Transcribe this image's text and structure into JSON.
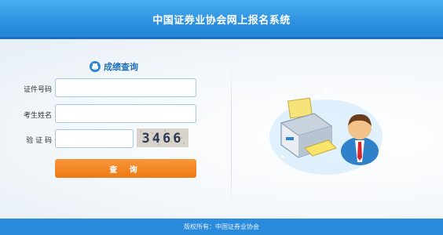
{
  "header": {
    "title": "中国证券业协会网上报名系统"
  },
  "form": {
    "title": "成绩查询",
    "id_label": "证件号码",
    "id_value": "",
    "name_label": "考生姓名",
    "name_value": "",
    "code_label": "验 证 码",
    "code_value": "",
    "captcha_text": "3466",
    "submit_label": "查 询"
  },
  "footer": {
    "text": "版权所有：中国证券业协会"
  },
  "colors": {
    "header": "#2c8fe0",
    "button": "#f28a24",
    "input_border": "#9fc8ea",
    "title_text": "#1f6fb8"
  }
}
